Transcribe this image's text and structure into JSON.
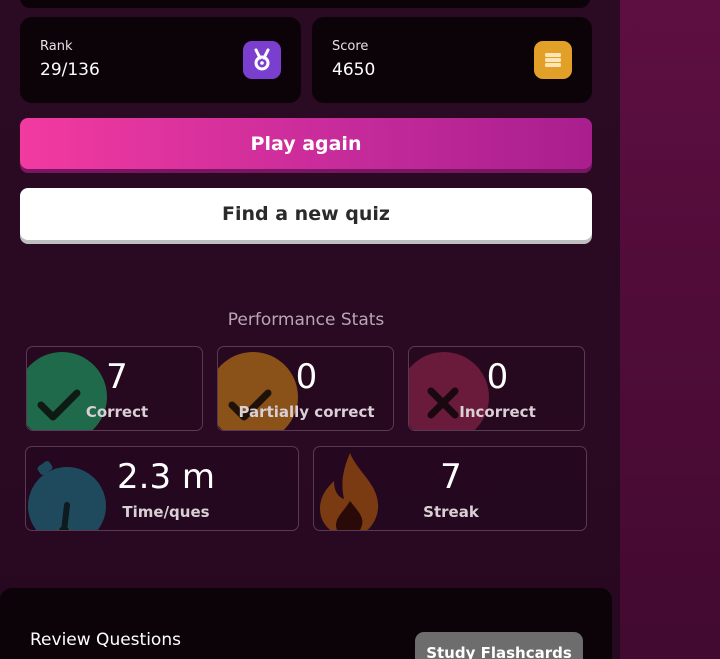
{
  "summary": {
    "rank_label": "Rank",
    "rank_value": "29/136",
    "score_label": "Score",
    "score_value": "4650"
  },
  "actions": {
    "play_again": "Play again",
    "find_quiz": "Find a new quiz"
  },
  "performance": {
    "title": "Performance Stats",
    "correct": {
      "value": "7",
      "label": "Correct"
    },
    "partial": {
      "value": "0",
      "label": "Partially correct"
    },
    "incorrect": {
      "value": "0",
      "label": "Incorrect"
    },
    "time": {
      "value": "2.3 m",
      "label": "Time/ques"
    },
    "streak": {
      "value": "7",
      "label": "Streak"
    }
  },
  "review": {
    "title": "Review Questions",
    "flashcards_button": "Study Flashcards"
  },
  "colors": {
    "play_gradient_start": "#f23aa0",
    "play_gradient_end": "#a91e8e",
    "rank_badge": "#7b3fcf",
    "score_badge": "#e3a028",
    "correct_green": "#1f6a4a",
    "partial_orange": "#8a5218",
    "incorrect_red": "#6a1a3a",
    "time_blue": "#1f4a5e",
    "streak_orange": "#7a3a12"
  },
  "icons": {
    "rank": "medal-icon",
    "score": "coins-icon",
    "correct": "check-icon",
    "partial": "check-icon",
    "incorrect": "x-icon",
    "time": "stopwatch-icon",
    "streak": "flame-icon"
  }
}
